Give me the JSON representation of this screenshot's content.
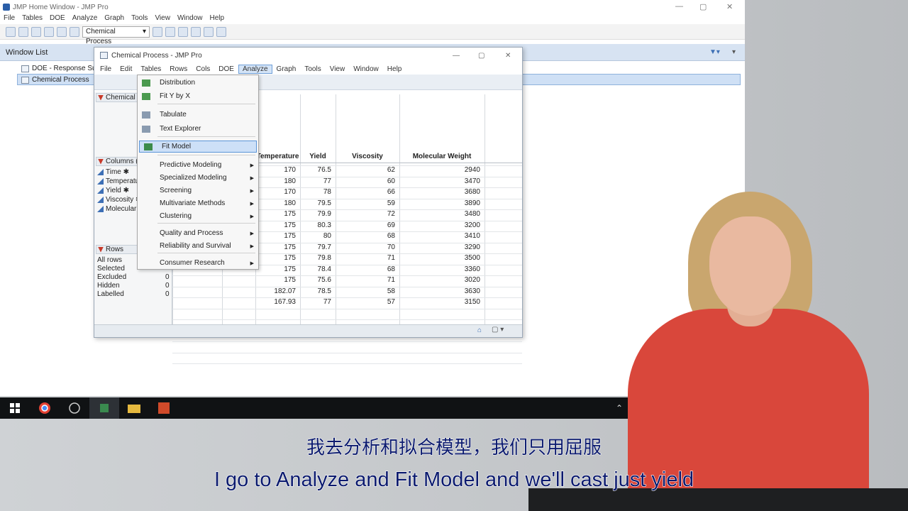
{
  "home": {
    "title": "JMP Home Window - JMP Pro",
    "menu": [
      "File",
      "Tables",
      "DOE",
      "Analyze",
      "Graph",
      "Tools",
      "View",
      "Window",
      "Help"
    ],
    "table_combo": "Chemical Process",
    "window_list_label": "Window List",
    "tree_items": [
      "DOE - Response Surf",
      "Chemical Process"
    ]
  },
  "dt": {
    "title": "Chemical Process - JMP Pro",
    "menu": [
      "File",
      "Edit",
      "Tables",
      "Rows",
      "Cols",
      "DOE",
      "Analyze",
      "Graph",
      "Tools",
      "View",
      "Window",
      "Help"
    ],
    "table_panel": "Chemical I",
    "columns_panel": "Columns (",
    "columns": [
      "Time ✱",
      "Temperatu",
      "Yield ✱",
      "Viscosity ✱",
      "Molecular"
    ],
    "rows_panel": "Rows",
    "rows_labels": [
      "All rows",
      "Selected",
      "Excluded",
      "Hidden",
      "Labelled"
    ],
    "rows_values": [
      "",
      "",
      "0",
      "0",
      "0"
    ],
    "headers": [
      "Temperature",
      "Yield",
      "Viscosity",
      "Molecular Weight"
    ],
    "rows": [
      [
        "170",
        "76.5",
        "62",
        "2940"
      ],
      [
        "180",
        "77",
        "60",
        "3470"
      ],
      [
        "170",
        "78",
        "66",
        "3680"
      ],
      [
        "180",
        "79.5",
        "59",
        "3890"
      ],
      [
        "175",
        "79.9",
        "72",
        "3480"
      ],
      [
        "175",
        "80.3",
        "69",
        "3200"
      ],
      [
        "175",
        "80",
        "68",
        "3410"
      ],
      [
        "175",
        "79.7",
        "70",
        "3290"
      ],
      [
        "175",
        "79.8",
        "71",
        "3500"
      ],
      [
        "175",
        "78.4",
        "68",
        "3360"
      ],
      [
        "175",
        "75.6",
        "71",
        "3020"
      ],
      [
        "182.07",
        "78.5",
        "58",
        "3630"
      ],
      [
        "167.93",
        "77",
        "57",
        "3150"
      ]
    ]
  },
  "analyze_menu": {
    "items": [
      {
        "label": "Distribution",
        "icon": "distribution-icon",
        "sub": false
      },
      {
        "label": "Fit Y by X",
        "icon": "fit-y-by-x-icon",
        "sub": false
      },
      {
        "label": "Tabulate",
        "icon": "tabulate-icon",
        "sub": false
      },
      {
        "label": "Text Explorer",
        "icon": "text-explorer-icon",
        "sub": false
      },
      {
        "label": "Fit Model",
        "icon": "fit-model-icon",
        "sub": false
      },
      {
        "label": "Predictive Modeling",
        "sub": true
      },
      {
        "label": "Specialized Modeling",
        "sub": true
      },
      {
        "label": "Screening",
        "sub": true
      },
      {
        "label": "Multivariate Methods",
        "sub": true
      },
      {
        "label": "Clustering",
        "sub": true
      },
      {
        "label": "Quality and Process",
        "sub": true
      },
      {
        "label": "Reliability and Survival",
        "sub": true
      },
      {
        "label": "Consumer Research",
        "sub": true
      }
    ]
  },
  "subtitles": {
    "cn": "我去分析和拟合模型，我们只用屈服",
    "en": "I go to Analyze and Fit Model and we'll cast just yield"
  },
  "colors": {
    "accent": "#5b95d8",
    "subtitle": "#0b1a6e",
    "dress": "#d9473b"
  }
}
